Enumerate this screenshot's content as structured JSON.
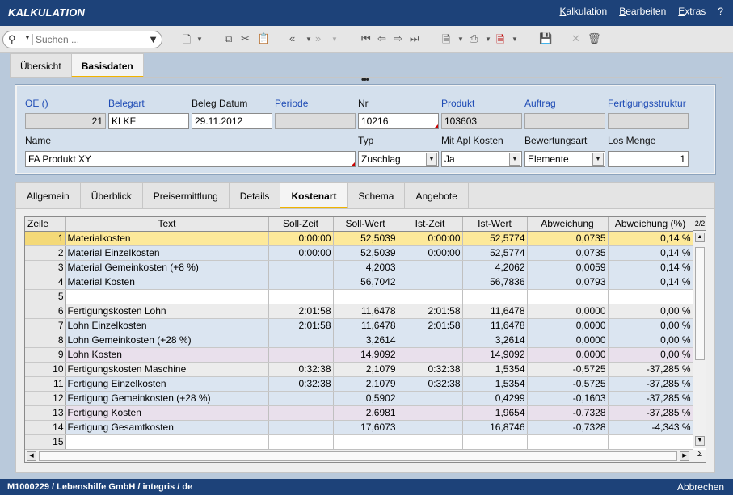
{
  "app": {
    "title": "KALKULATION",
    "menu": [
      "Kalkulation",
      "Bearbeiten",
      "Extras",
      "?"
    ]
  },
  "toolbar": {
    "search_placeholder": "Suchen ..."
  },
  "tabs_top": [
    {
      "label": "Übersicht",
      "active": false
    },
    {
      "label": "Basisdaten",
      "active": true
    }
  ],
  "form": {
    "row1": {
      "oe": {
        "label": "OE ()",
        "value": "21"
      },
      "belegart": {
        "label": "Belegart",
        "value": "KLKF"
      },
      "belegdatum": {
        "label": "Beleg Datum",
        "value": "29.11.2012"
      },
      "periode": {
        "label": "Periode",
        "value": ""
      },
      "nr": {
        "label": "Nr",
        "value": "10216"
      },
      "produkt": {
        "label": "Produkt",
        "value": "103603"
      },
      "auftrag": {
        "label": "Auftrag",
        "value": ""
      },
      "fertigungsstruktur": {
        "label": "Fertigungsstruktur",
        "value": ""
      }
    },
    "row2": {
      "name": {
        "label": "Name",
        "value": "FA Produkt XY"
      },
      "typ": {
        "label": "Typ",
        "value": "Zuschlag"
      },
      "mitapl": {
        "label": "Mit Apl Kosten",
        "value": "Ja"
      },
      "bewertungsart": {
        "label": "Bewertungsart",
        "value": "Elemente"
      },
      "losmenge": {
        "label": "Los Menge",
        "value": "1"
      }
    }
  },
  "tabs_detail": [
    {
      "label": "Allgemein",
      "active": false
    },
    {
      "label": "Überblick",
      "active": false
    },
    {
      "label": "Preisermittlung",
      "active": false
    },
    {
      "label": "Details",
      "active": false
    },
    {
      "label": "Kostenart",
      "active": true
    },
    {
      "label": "Schema",
      "active": false
    },
    {
      "label": "Angebote",
      "active": false
    }
  ],
  "grid": {
    "pager": "2/2",
    "sigma": "Σ",
    "columns": [
      "Zeile",
      "Text",
      "Soll-Zeit",
      "Soll-Wert",
      "Ist-Zeit",
      "Ist-Wert",
      "Abweichung",
      "Abweichung (%)"
    ],
    "rows": [
      {
        "style": "sel",
        "cells": [
          "1",
          "Materialkosten",
          "0:00:00",
          "52,5039",
          "0:00:00",
          "52,5774",
          "0,0735",
          "0,14 %"
        ]
      },
      {
        "style": "blue",
        "cells": [
          "2",
          "Material Einzelkosten",
          "0:00:00",
          "52,5039",
          "0:00:00",
          "52,5774",
          "0,0735",
          "0,14 %"
        ]
      },
      {
        "style": "blue",
        "cells": [
          "3",
          "Material Gemeinkosten  (+8 %)",
          "",
          "4,2003",
          "",
          "4,2062",
          "0,0059",
          "0,14 %"
        ]
      },
      {
        "style": "blue",
        "cells": [
          "4",
          "Material Kosten",
          "",
          "56,7042",
          "",
          "56,7836",
          "0,0793",
          "0,14 %"
        ]
      },
      {
        "style": "white",
        "cells": [
          "5",
          "",
          "",
          "",
          "",
          "",
          "",
          ""
        ]
      },
      {
        "style": "grey",
        "cells": [
          "6",
          "Fertigungskosten Lohn",
          "2:01:58",
          "11,6478",
          "2:01:58",
          "11,6478",
          "0,0000",
          "0,00 %"
        ]
      },
      {
        "style": "blue",
        "cells": [
          "7",
          "Lohn Einzelkosten",
          "2:01:58",
          "11,6478",
          "2:01:58",
          "11,6478",
          "0,0000",
          "0,00 %"
        ]
      },
      {
        "style": "blue",
        "cells": [
          "8",
          "Lohn Gemeinkosten  (+28 %)",
          "",
          "3,2614",
          "",
          "3,2614",
          "0,0000",
          "0,00 %"
        ]
      },
      {
        "style": "purple",
        "cells": [
          "9",
          "Lohn Kosten",
          "",
          "14,9092",
          "",
          "14,9092",
          "0,0000",
          "0,00 %"
        ]
      },
      {
        "style": "grey",
        "cells": [
          "10",
          "Fertigungskosten Maschine",
          "0:32:38",
          "2,1079",
          "0:32:38",
          "1,5354",
          "-0,5725",
          "-37,285 %"
        ]
      },
      {
        "style": "blue",
        "cells": [
          "11",
          "Fertigung Einzelkosten",
          "0:32:38",
          "2,1079",
          "0:32:38",
          "1,5354",
          "-0,5725",
          "-37,285 %"
        ]
      },
      {
        "style": "blue",
        "cells": [
          "12",
          "Fertigung Gemeinkosten  (+28 %)",
          "",
          "0,5902",
          "",
          "0,4299",
          "-0,1603",
          "-37,285 %"
        ]
      },
      {
        "style": "purple",
        "cells": [
          "13",
          "Fertigung Kosten",
          "",
          "2,6981",
          "",
          "1,9654",
          "-0,7328",
          "-37,285 %"
        ]
      },
      {
        "style": "blue",
        "cells": [
          "14",
          "Fertigung Gesamtkosten",
          "",
          "17,6073",
          "",
          "16,8746",
          "-0,7328",
          "-4,343 %"
        ]
      },
      {
        "style": "white",
        "cells": [
          "15",
          "",
          "",
          "",
          "",
          "",
          "",
          ""
        ]
      }
    ]
  },
  "status": {
    "left": "M1000229 / Lebenshilfe  GmbH / integris / de",
    "right": "Abbrechen"
  }
}
